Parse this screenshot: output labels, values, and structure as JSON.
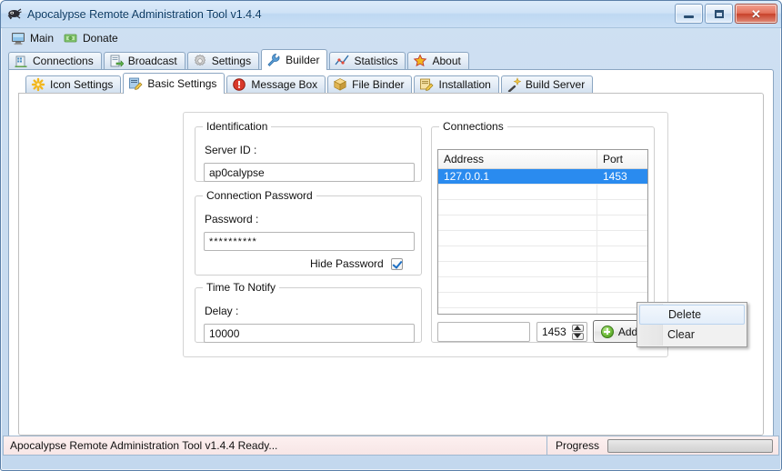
{
  "window": {
    "title": "Apocalypse Remote Administration Tool v1.4.4",
    "app_icon": "apocalypse-logo-icon",
    "buttons": {
      "minimize": "minimize-icon",
      "maximize": "maximize-icon",
      "close": "✕"
    }
  },
  "menubar": {
    "items": [
      {
        "label": "Main",
        "icon": "monitor-icon"
      },
      {
        "label": "Donate",
        "icon": "money-icon"
      }
    ]
  },
  "outer_tabs": {
    "items": [
      {
        "label": "Connections",
        "icon": "building-icon",
        "selected": false
      },
      {
        "label": "Broadcast",
        "icon": "broadcast-icon",
        "selected": false
      },
      {
        "label": "Settings",
        "icon": "gear-icon",
        "selected": false
      },
      {
        "label": "Builder",
        "icon": "wrench-icon",
        "selected": true
      },
      {
        "label": "Statistics",
        "icon": "chart-icon",
        "selected": false
      },
      {
        "label": "About",
        "icon": "star-icon",
        "selected": false
      }
    ]
  },
  "inner_tabs": {
    "items": [
      {
        "label": "Icon Settings",
        "icon": "asterisk-icon",
        "selected": false
      },
      {
        "label": "Basic Settings",
        "icon": "notepad-icon",
        "selected": true
      },
      {
        "label": "Message Box",
        "icon": "exclamation-icon",
        "selected": false
      },
      {
        "label": "File Binder",
        "icon": "package-icon",
        "selected": false
      },
      {
        "label": "Installation",
        "icon": "install-icon",
        "selected": false
      },
      {
        "label": "Build Server",
        "icon": "wand-icon",
        "selected": false
      }
    ]
  },
  "identification": {
    "legend": "Identification",
    "server_id_label": "Server ID :",
    "server_id_value": "ap0calypse"
  },
  "connection_password": {
    "legend": "Connection Password",
    "password_label": "Password :",
    "password_value": "**********",
    "hide_password_label": "Hide Password",
    "hide_password_checked": true
  },
  "time_to_notify": {
    "legend": "Time To Notify",
    "delay_label": "Delay :",
    "delay_value": "10000"
  },
  "connections_panel": {
    "legend": "Connections",
    "columns": [
      "Address",
      "Port"
    ],
    "rows": [
      {
        "address": "127.0.0.1",
        "port": "1453",
        "selected": true
      },
      {
        "address": "",
        "port": "",
        "selected": false
      },
      {
        "address": "",
        "port": "",
        "selected": false
      },
      {
        "address": "",
        "port": "",
        "selected": false
      },
      {
        "address": "",
        "port": "",
        "selected": false
      },
      {
        "address": "",
        "port": "",
        "selected": false
      },
      {
        "address": "",
        "port": "",
        "selected": false
      },
      {
        "address": "",
        "port": "",
        "selected": false
      },
      {
        "address": "",
        "port": "",
        "selected": false
      },
      {
        "address": "",
        "port": "",
        "selected": false
      }
    ],
    "address_input_value": "",
    "port_spinner_value": "1453",
    "add_button_label": "Add",
    "add_button_icon": "green-plus-icon"
  },
  "context_menu": {
    "items": [
      {
        "label": "Delete",
        "hover": true
      },
      {
        "label": "Clear",
        "hover": false
      }
    ]
  },
  "statusbar": {
    "message": "Apocalypse Remote Administration Tool v1.4.4 Ready...",
    "progress_label": "Progress",
    "progress_value": 0
  },
  "colors": {
    "selection_blue": "#2a8bef",
    "title_text": "#0b3a63",
    "close_red": "#c8412a",
    "accent_green": "#6fbc3a"
  }
}
